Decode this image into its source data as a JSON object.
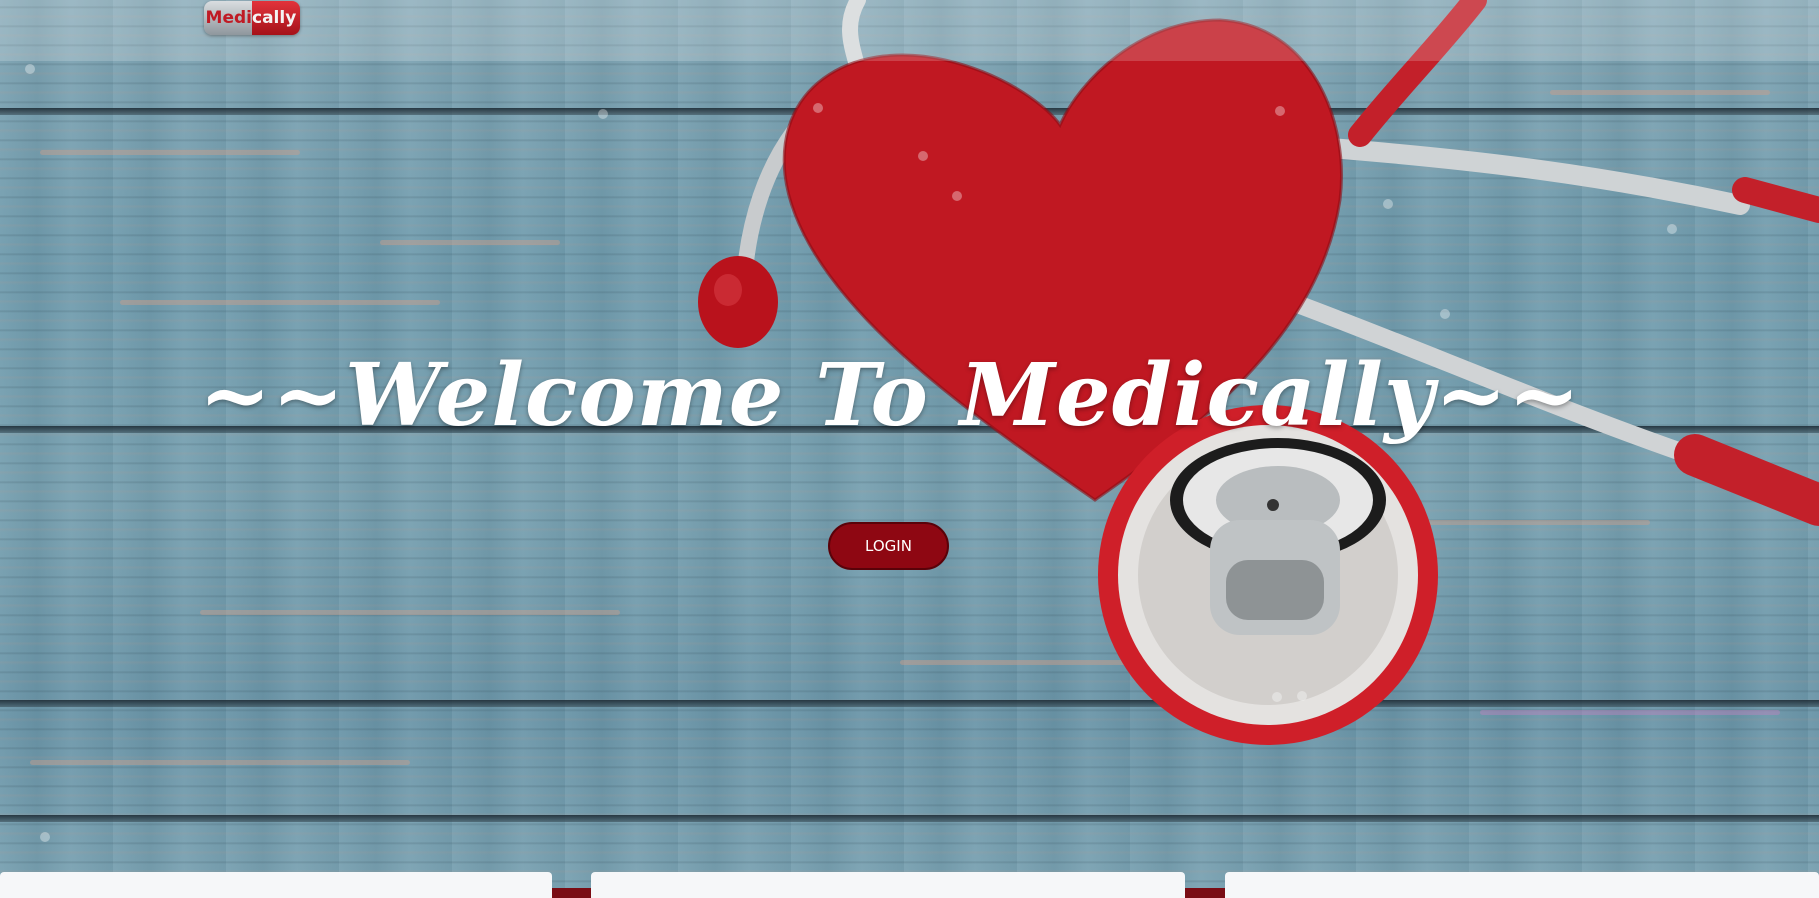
{
  "header": {
    "logo": {
      "part1": "Medi",
      "part2": "cally"
    }
  },
  "hero": {
    "headline": "~~Welcome To Medically~~",
    "login_label": "LOGIN"
  },
  "colors": {
    "brand_red": "#8e0712",
    "heart_red": "#c01822",
    "headline": "#ffffff",
    "card_bg": "#f6f7f9"
  },
  "icons": [
    "heart-illustration",
    "stethoscope-illustration"
  ]
}
